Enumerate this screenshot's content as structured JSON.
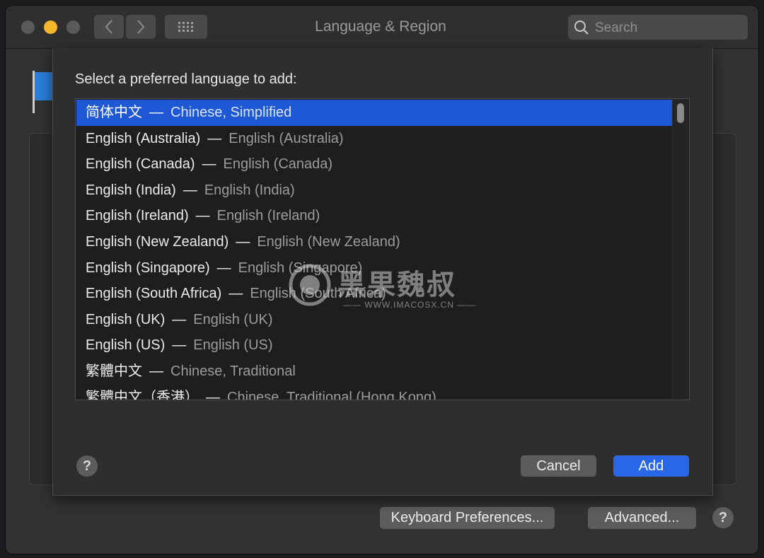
{
  "window": {
    "title": "Language & Region"
  },
  "search": {
    "placeholder": "Search"
  },
  "sheet": {
    "prompt": "Select a preferred language to add:",
    "languages": [
      {
        "native": "简体中文",
        "english": "Chinese, Simplified",
        "selected": true
      },
      {
        "native": "English (Australia)",
        "english": "English (Australia)"
      },
      {
        "native": "English (Canada)",
        "english": "English (Canada)"
      },
      {
        "native": "English (India)",
        "english": "English (India)"
      },
      {
        "native": "English (Ireland)",
        "english": "English (Ireland)"
      },
      {
        "native": "English (New Zealand)",
        "english": "English (New Zealand)"
      },
      {
        "native": "English (Singapore)",
        "english": "English (Singapore)"
      },
      {
        "native": "English (South Africa)",
        "english": "English (South Africa)"
      },
      {
        "native": "English (UK)",
        "english": "English (UK)"
      },
      {
        "native": "English (US)",
        "english": "English (US)"
      },
      {
        "native": "繁體中文",
        "english": "Chinese, Traditional"
      },
      {
        "native": "繁體中文（香港）",
        "english": "Chinese, Traditional (Hong Kong)"
      }
    ],
    "separator": "—",
    "cancel_label": "Cancel",
    "add_label": "Add",
    "help_label": "?"
  },
  "footer": {
    "keyboard_prefs_label": "Keyboard Preferences...",
    "advanced_label": "Advanced...",
    "help_label": "?"
  },
  "watermark": {
    "text": "黑果魏叔",
    "url": "—— WWW.IMACOSX.CN ——"
  },
  "colors": {
    "accent": "#2868e8",
    "selection": "#1f58d5",
    "minimize": "#f4b72c"
  },
  "icons": [
    "back-icon",
    "forward-icon",
    "grid-icon",
    "search-icon",
    "flag-icon"
  ]
}
